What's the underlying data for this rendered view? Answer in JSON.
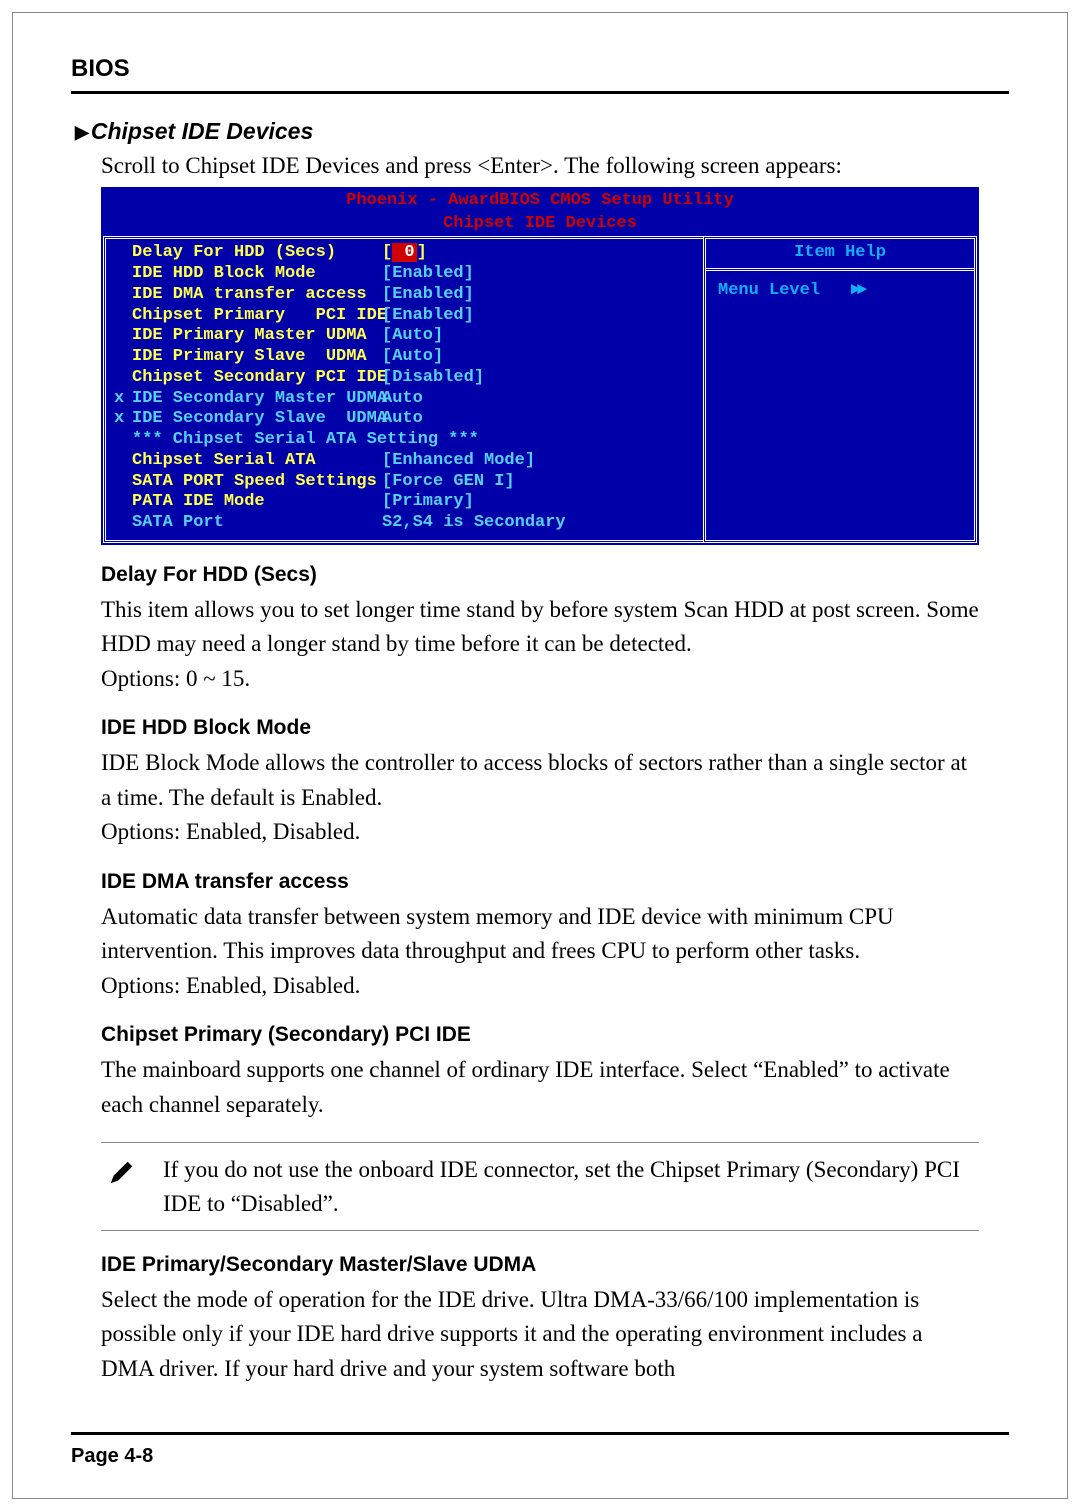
{
  "header": "BIOS",
  "h2": "Chipset IDE Devices",
  "intro": "Scroll to Chipset IDE Devices and press <Enter>. The following screen appears:",
  "bios": {
    "title1": "Phoenix - AwardBIOS CMOS Setup Utility",
    "title2": "Chipset IDE Devices",
    "help_head": "Item Help",
    "help_line": "Menu Level",
    "rows": [
      {
        "pre": "",
        "label": "Delay For HDD (Secs)",
        "lcls": "y",
        "val": "[",
        "vcls": "y",
        "hl": "0",
        "after": "]"
      },
      {
        "pre": "",
        "label": "IDE HDD Block Mode",
        "lcls": "y",
        "val": "[Enabled]",
        "vcls": "c"
      },
      {
        "pre": "",
        "label": "IDE DMA transfer access",
        "lcls": "y",
        "val": "[Enabled]",
        "vcls": "c"
      },
      {
        "pre": "",
        "label": "Chipset Primary   PCI IDE",
        "lcls": "y",
        "val": "[Enabled]",
        "vcls": "c"
      },
      {
        "pre": "",
        "label": "IDE Primary Master UDMA",
        "lcls": "y",
        "val": "[Auto]",
        "vcls": "c"
      },
      {
        "pre": "",
        "label": "IDE Primary Slave  UDMA",
        "lcls": "y",
        "val": "[Auto]",
        "vcls": "c"
      },
      {
        "pre": "",
        "label": "Chipset Secondary PCI IDE",
        "lcls": "y",
        "val": "[Disabled]",
        "vcls": "c"
      },
      {
        "pre": "x",
        "label": "IDE Secondary Master UDMA",
        "lcls": "c",
        "val": "Auto",
        "vcls": "c"
      },
      {
        "pre": "x",
        "label": "IDE Secondary Slave  UDMA",
        "lcls": "c",
        "val": "Auto",
        "vcls": "c"
      },
      {
        "pre": "",
        "label": "",
        "lcls": "c",
        "val": "",
        "vcls": "c"
      },
      {
        "pre": "",
        "label": "*** Chipset Serial ATA Setting ***",
        "lcls": "c",
        "val": "",
        "vcls": "c"
      },
      {
        "pre": "",
        "label": "Chipset Serial ATA",
        "lcls": "y",
        "val": "[Enhanced Mode]",
        "vcls": "c"
      },
      {
        "pre": "",
        "label": "SATA PORT Speed Settings",
        "lcls": "y",
        "val": "[Force GEN I]",
        "vcls": "c"
      },
      {
        "pre": "",
        "label": "PATA IDE Mode",
        "lcls": "y",
        "val": "[Primary]",
        "vcls": "c"
      },
      {
        "pre": "",
        "label": "SATA Port",
        "lcls": "c",
        "val": "S2,S4 is Secondary",
        "vcls": "c"
      }
    ]
  },
  "sections": [
    {
      "h": "Delay For HDD (Secs)",
      "p": "This item allows you to set longer time stand by before system Scan HDD at post screen. Some HDD may need a longer stand by time before it can be detected.",
      "opt": "Options: 0 ~ 15."
    },
    {
      "h": "IDE HDD Block Mode",
      "p": "IDE Block Mode allows the controller to access blocks of sectors rather than a single sector at a time. The default is Enabled.",
      "opt": "Options: Enabled, Disabled."
    },
    {
      "h": "IDE DMA transfer access",
      "p": "Automatic data transfer between system memory and IDE device with minimum CPU intervention. This improves data throughput and frees CPU to perform other tasks.",
      "opt": "Options: Enabled, Disabled."
    },
    {
      "h": "Chipset Primary (Secondary) PCI IDE",
      "p": "The mainboard supports one channel of ordinary IDE interface.  Select “Enabled” to activate each channel separately.",
      "opt": ""
    }
  ],
  "note": "If you do not use the onboard IDE connector, set the Chipset Primary (Secondary) PCI IDE to “Disabled”.",
  "section5": {
    "h": "IDE Primary/Secondary Master/Slave UDMA",
    "p": "Select the mode of operation for the IDE drive.  Ultra DMA-33/66/100 implementation is possible only if your IDE hard drive supports it and the operating environment includes a DMA driver. If your hard drive and your system software both"
  },
  "footer": "Page 4-8"
}
